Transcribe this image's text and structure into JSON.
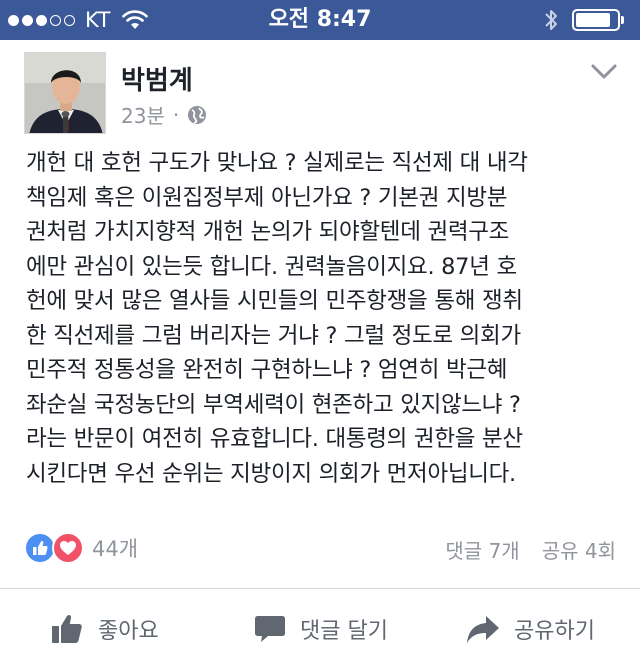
{
  "status_bar": {
    "carrier": "KT",
    "time": "오전 8:47",
    "signal_bars_filled": 3,
    "signal_bars_total": 5,
    "battery_level": 0.85
  },
  "post": {
    "author": "박범계",
    "time_ago": "23분",
    "separator": "·",
    "privacy_icon": "globe-icon",
    "menu_icon": "chevron-down-icon",
    "body_lines": [
      "개헌 대 호헌 구도가 맞나요 ? 실제로는 직선제 대 내각",
      "책임제 혹은 이원집정부제 아닌가요 ? 기본권 지방분",
      "권처럼 가치지향적 개헌 논의가 되야할텐데 권력구조",
      "에만 관심이 있는듯 합니다. 권력놀음이지요. 87년 호",
      "헌에 맞서 많은 열사들 시민들의 민주항쟁을 통해 쟁취",
      "한 직선제를 그럼 버리자는 거냐 ? 그럴 정도로 의회가",
      "민주적 정통성을 완전히 구현하느냐 ? 엄연히 박근혜",
      "좌순실 국정농단의 부역세력이 현존하고 있지않느냐 ?",
      "라는 반문이 여전히 유효합니다. 대통령의 권한을 분산",
      "시킨다면 우선 순위는 지방이지 의회가 먼저아닙니다."
    ],
    "reactions_count": "44개",
    "comments_count": "댓글 7개",
    "shares_count": "공유 4회"
  },
  "actions": {
    "like_label": "좋아요",
    "comment_label": "댓글 달기",
    "share_label": "공유하기"
  },
  "colors": {
    "status_bar_bg": "#3b5998",
    "like_blue": "#4d8ff2",
    "love_red": "#f25268",
    "meta_gray": "#90949c",
    "action_gray": "#606770"
  }
}
